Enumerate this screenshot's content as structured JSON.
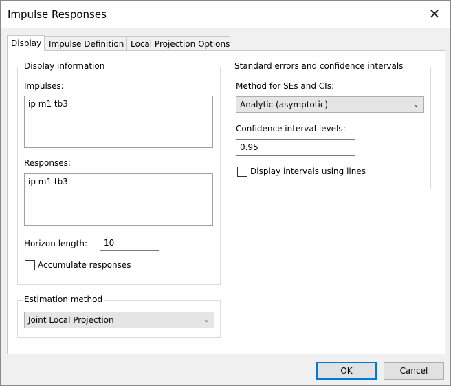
{
  "window": {
    "title": "Impulse Responses",
    "close_glyph": "✕"
  },
  "tabs": [
    {
      "label": "Display",
      "active": true
    },
    {
      "label": "Impulse Definition",
      "active": false
    },
    {
      "label": "Local Projection Options",
      "active": false
    }
  ],
  "display_information": {
    "legend": "Display information",
    "impulses_label": "Impulses:",
    "impulses_value": "ip m1 tb3",
    "responses_label": "Responses:",
    "responses_value": "ip m1 tb3",
    "horizon_label": "Horizon length:",
    "horizon_value": "10",
    "accumulate_label": "Accumulate responses",
    "accumulate_checked": false
  },
  "estimation": {
    "legend": "Estimation method",
    "selected": "Joint Local Projection"
  },
  "se_ci": {
    "legend": "Standard errors and confidence intervals",
    "method_label": "Method for SEs and CIs:",
    "method_selected": "Analytic (asymptotic)",
    "levels_label": "Confidence interval levels:",
    "levels_value": "0.95",
    "lines_label": "Display intervals using lines",
    "lines_checked": false
  },
  "buttons": {
    "ok": "OK",
    "cancel": "Cancel"
  },
  "icons": {
    "close": "close-icon",
    "dropdown": "chevron-down-icon"
  },
  "colors": {
    "accent": "#0078d7",
    "dialog_bg": "#f0f0f0",
    "panel_bg": "#ffffff"
  }
}
